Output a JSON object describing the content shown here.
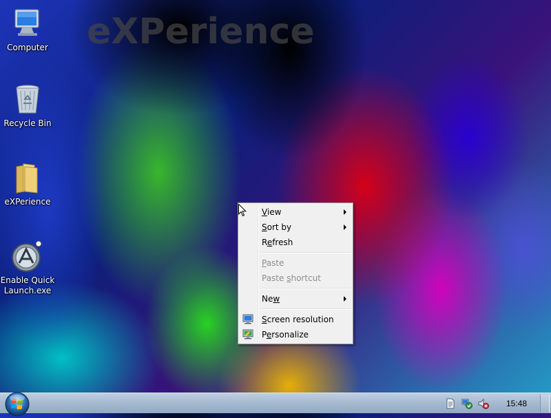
{
  "wallpaper": {
    "watermark_text": "eXPerience"
  },
  "desktop_icons": [
    {
      "label": "Computer",
      "icon": "computer-icon"
    },
    {
      "label": "Recycle Bin",
      "icon": "recycle-bin-icon"
    },
    {
      "label": "eXPerience",
      "icon": "folder-icon"
    },
    {
      "label": "Enable Quick Launch.exe",
      "icon": "app-icon"
    }
  ],
  "context_menu": {
    "items": [
      {
        "pre": "",
        "key": "V",
        "post": "iew",
        "submenu": true,
        "enabled": true
      },
      {
        "pre": "",
        "key": "S",
        "post": "ort by",
        "submenu": true,
        "enabled": true
      },
      {
        "pre": "R",
        "key": "e",
        "post": "fresh",
        "submenu": false,
        "enabled": true
      },
      {
        "pre": "",
        "key": "P",
        "post": "aste",
        "submenu": false,
        "enabled": false
      },
      {
        "pre": "Paste ",
        "key": "s",
        "post": "hortcut",
        "submenu": false,
        "enabled": false
      },
      {
        "pre": "Ne",
        "key": "w",
        "post": "",
        "submenu": true,
        "enabled": true
      },
      {
        "pre": "",
        "key": "S",
        "post": "creen resolution",
        "submenu": false,
        "enabled": true,
        "icon": "display-icon"
      },
      {
        "pre": "P",
        "key": "e",
        "post": "rsonalize",
        "submenu": false,
        "enabled": true,
        "icon": "personalize-icon"
      }
    ]
  },
  "taskbar": {
    "start_icon": "windows-orb-icon",
    "tray_icons": [
      "document-icon",
      "network-icon",
      "volume-muted-icon"
    ],
    "clock": "15:48"
  }
}
